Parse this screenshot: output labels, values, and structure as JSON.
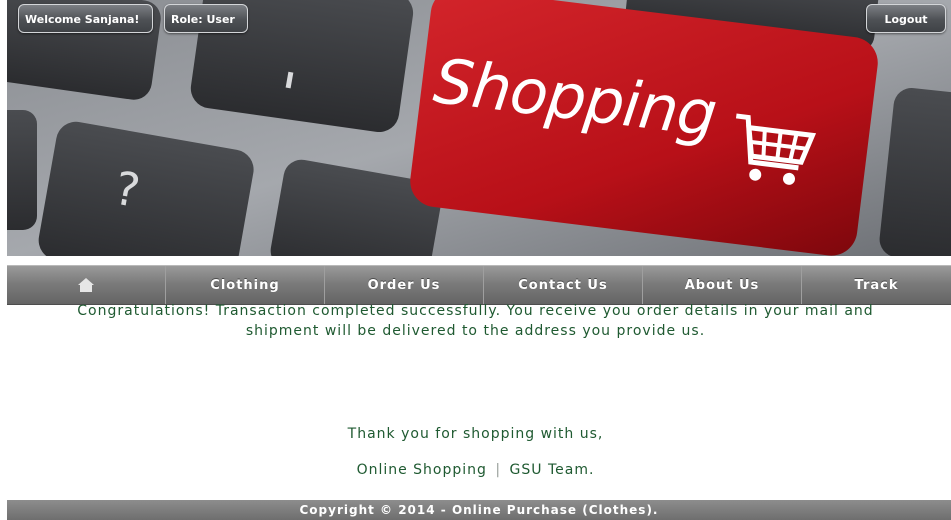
{
  "header": {
    "welcome_label": "Welcome Sanjana!",
    "role_label": "Role: User",
    "logout_label": "Logout"
  },
  "banner": {
    "text": "Shopping",
    "key_color": "#c2151d"
  },
  "nav": {
    "home_icon": "home-icon",
    "items": [
      {
        "label": "Clothing"
      },
      {
        "label": "Order Us"
      },
      {
        "label": "Contact Us"
      },
      {
        "label": "About Us"
      },
      {
        "label": "Track"
      }
    ]
  },
  "main": {
    "message_line1": "Congratulations! Transaction completed successfully. You receive you order details in your mail and",
    "message_line2": "shipment will be delivered to the address you provide us.",
    "thanks": "Thank you for shopping with us,",
    "team_part1": "Online Shopping",
    "team_separator": "|",
    "team_part2": "GSU Team."
  },
  "footer": {
    "copyright": "Copyright © 2014 - Online Purchase (Clothes)."
  }
}
